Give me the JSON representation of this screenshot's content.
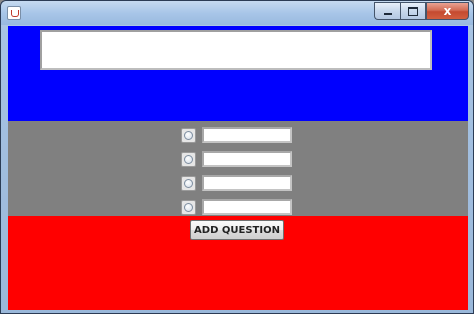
{
  "window": {
    "title": "",
    "close_glyph": "x",
    "icons": {
      "app": "java-cup-icon",
      "minimize": "minimize-icon",
      "maximize": "maximize-icon",
      "close": "close-icon"
    }
  },
  "question": {
    "value": "",
    "placeholder": ""
  },
  "options": [
    {
      "selected": false,
      "value": ""
    },
    {
      "selected": false,
      "value": ""
    },
    {
      "selected": false,
      "value": ""
    },
    {
      "selected": false,
      "value": ""
    }
  ],
  "actions": {
    "add_question_label": "ADD QUESTION"
  },
  "colors": {
    "top_panel": "#0000ff",
    "middle_panel": "#808080",
    "bottom_panel": "#ff0000"
  }
}
